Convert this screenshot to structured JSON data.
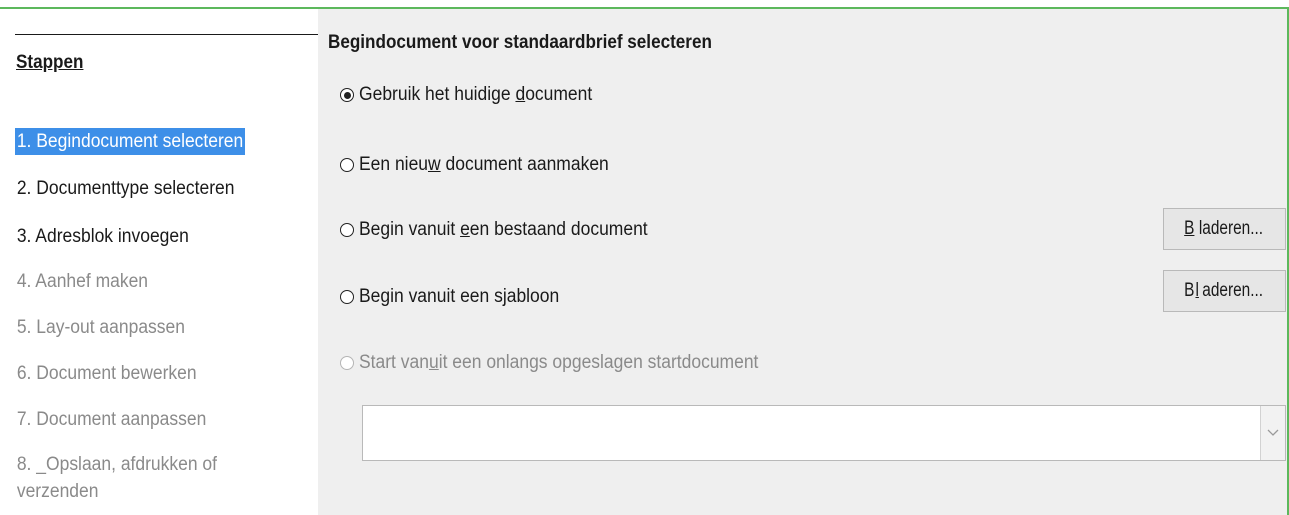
{
  "sidebar": {
    "title": "Stappen",
    "steps": [
      {
        "label": "1. Begindocument selecteren",
        "state": "selected"
      },
      {
        "label": "2. Documenttype selecteren",
        "state": "enabled"
      },
      {
        "label": "3. Adresblok invoegen",
        "state": "enabled"
      },
      {
        "label": "4. Aanhef maken",
        "state": "disabled"
      },
      {
        "label": "5. Lay-out aanpassen",
        "state": "disabled"
      },
      {
        "label": "6. Document bewerken",
        "state": "disabled"
      },
      {
        "label": "7. Document aanpassen",
        "state": "disabled"
      },
      {
        "label": "8. _Opslaan, afdrukken of verzenden",
        "state": "disabled"
      }
    ]
  },
  "main": {
    "title": "Begindocument voor standaardbrief selecteren",
    "options": {
      "current": {
        "pre": "Gebruik het huidige ",
        "key": "d",
        "post": "ocument",
        "selected": true
      },
      "new": {
        "pre": "Een nieu",
        "key": "w",
        "post": " document aanmaken",
        "selected": false
      },
      "existing": {
        "pre": "Begin vanuit ",
        "key": "e",
        "post": "en bestaand document",
        "selected": false
      },
      "template": {
        "pre": "Begin vanuit een s",
        "key": "j",
        "post": "abloon",
        "selected": false
      },
      "recent": {
        "pre": "Start van",
        "key": "u",
        "post": "it een onlangs opgeslagen startdocument",
        "selected": false,
        "disabled": true
      }
    },
    "browse_existing": {
      "key": "B",
      "rest": "laderen..."
    },
    "browse_template": {
      "pre": "B",
      "key": "l",
      "rest": "aderen..."
    },
    "recent_combo_value": ""
  },
  "colors": {
    "selection": "#3d8fe8",
    "frame": "#5cb85c",
    "panel": "#efefef",
    "disabled_text": "#8a8a8a"
  },
  "icons": {
    "radio_selected": "radio-selected-icon",
    "radio_unselected": "radio-unselected-icon",
    "combo_arrow": "chevron-down-icon"
  }
}
